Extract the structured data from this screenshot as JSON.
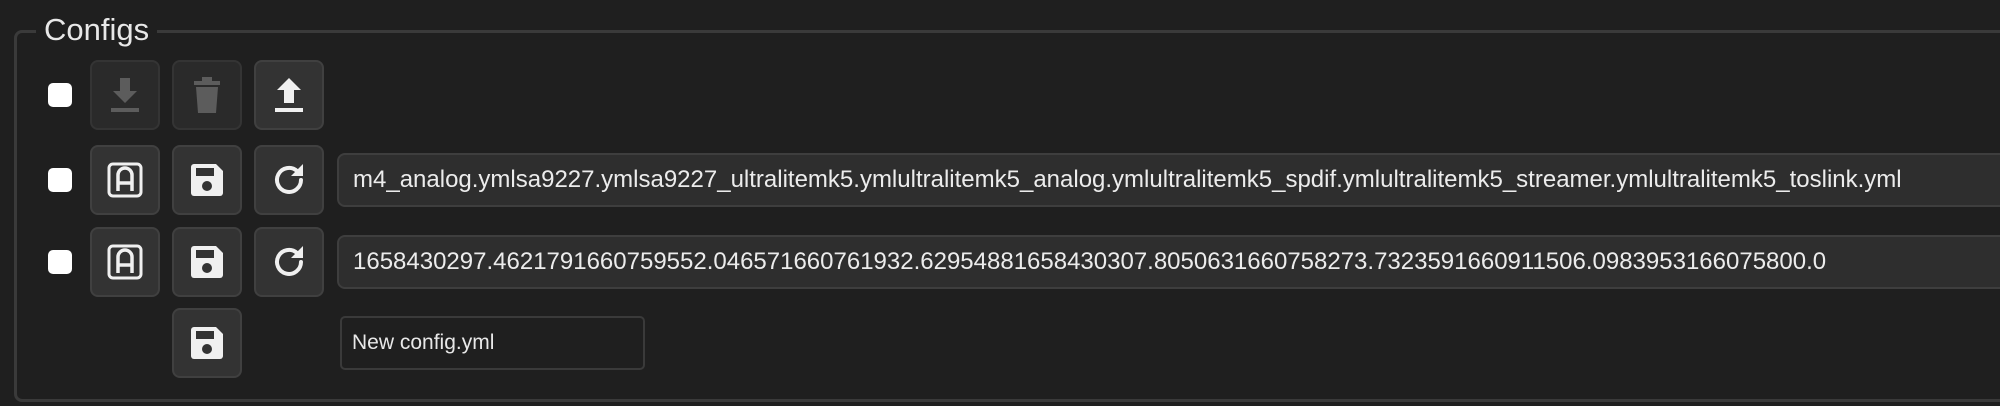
{
  "section": {
    "title": "Configs"
  },
  "toolbar": {
    "download_icon": "download-icon",
    "delete_icon": "trash-icon",
    "upload_icon": "upload-icon"
  },
  "files": [
    {
      "name": "m4_analog.ymlsa9227.ymlsa9227_ultralitemk5.ymlultralitemk5_analog.ymlultralitemk5_spdif.ymlultralitemk5_streamer.ymlultralitemk5_toslink.yml"
    },
    {
      "name": "1658430297.4621791660759552.046571660761932.62954881658430307.8050631660758273.7323591660911506.0983953166075800.0"
    }
  ],
  "new_config": {
    "placeholder": "New config.yml"
  },
  "colors": {
    "background": "#1f1f1f",
    "button": "#333333",
    "text": "#e6e6e6"
  }
}
